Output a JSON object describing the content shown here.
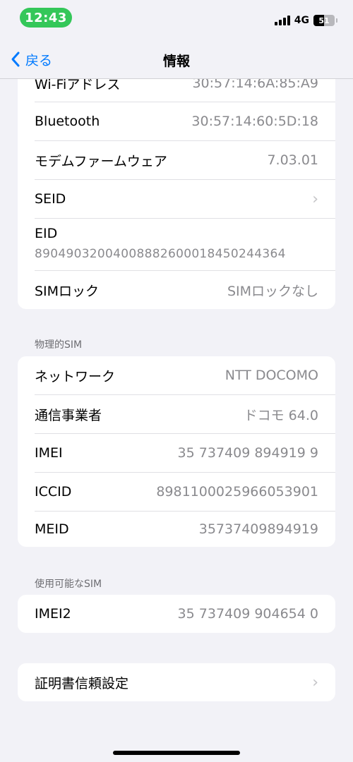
{
  "status": {
    "time": "12:43",
    "network": "4G",
    "battery_level": "51",
    "time_pill_color": "#34c759"
  },
  "nav": {
    "back_label": "戻る",
    "title": "情報"
  },
  "group1": {
    "wifi": {
      "label": "Wi-Fiアドレス",
      "value": "30:57:14:6A:85:A9"
    },
    "bluetooth": {
      "label": "Bluetooth",
      "value": "30:57:14:60:5D:18"
    },
    "modem": {
      "label": "モデムファームウェア",
      "value": "7.03.01"
    },
    "seid": {
      "label": "SEID"
    },
    "eid": {
      "label": "EID",
      "value": "89049032004008882600018450244364"
    },
    "simlock": {
      "label": "SIMロック",
      "value": "SIMロックなし"
    }
  },
  "physical_sim": {
    "header": "物理的SIM",
    "network": {
      "label": "ネットワーク",
      "value": "NTT DOCOMO"
    },
    "carrier": {
      "label": "通信事業者",
      "value": "ドコモ 64.0"
    },
    "imei": {
      "label": "IMEI",
      "value": "35 737409 894919 9"
    },
    "iccid": {
      "label": "ICCID",
      "value": "8981100025966053901"
    },
    "meid": {
      "label": "MEID",
      "value": "35737409894919"
    }
  },
  "available_sim": {
    "header": "使用可能なSIM",
    "imei2": {
      "label": "IMEI2",
      "value": "35 737409 904654 0"
    }
  },
  "certificate": {
    "label": "証明書信頼設定"
  },
  "colors": {
    "accent": "#007aff",
    "background": "#f2f2f7",
    "secondary_text": "#8a8a8e"
  }
}
